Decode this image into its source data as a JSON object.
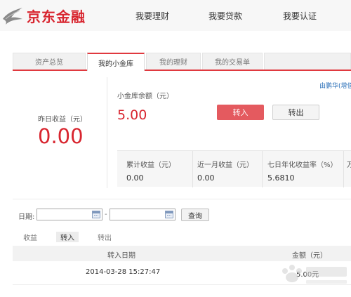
{
  "brand": {
    "name": "京东金融",
    "color": "#d8252f"
  },
  "topnav": {
    "items": [
      "我要理财",
      "我要贷款",
      "我要认证"
    ]
  },
  "tabs": [
    "资产总览",
    "我的小金库",
    "我的理财",
    "我的交易单",
    ""
  ],
  "price_link": "由鹏华(增值",
  "summary": {
    "yesterday_label": "昨日收益（元）",
    "yesterday_value": "0.00",
    "balance_label": "小金库余额（元）",
    "balance_value": "5.00",
    "transfer_in_label": "转入",
    "transfer_out_label": "转出"
  },
  "stats": [
    {
      "label": "累计收益（元）",
      "value": "0.00"
    },
    {
      "label": "近一月收益（元）",
      "value": "0.00"
    },
    {
      "label": "七日年化收益率（%）",
      "value": "5.6810"
    },
    {
      "label": "万",
      "value": ""
    }
  ],
  "filter": {
    "date_label": "日期:",
    "separator": "-",
    "query_label": "查询"
  },
  "subtabs": [
    "收益",
    "转入",
    "转出"
  ],
  "table": {
    "headers": [
      "转入日期",
      "金额（元）"
    ],
    "rows": [
      {
        "date": "2014-03-28 15:27:47",
        "amount": "5.00元"
      }
    ]
  },
  "colors": {
    "accent": "#e0393f",
    "button_red": "#e45a5f"
  }
}
